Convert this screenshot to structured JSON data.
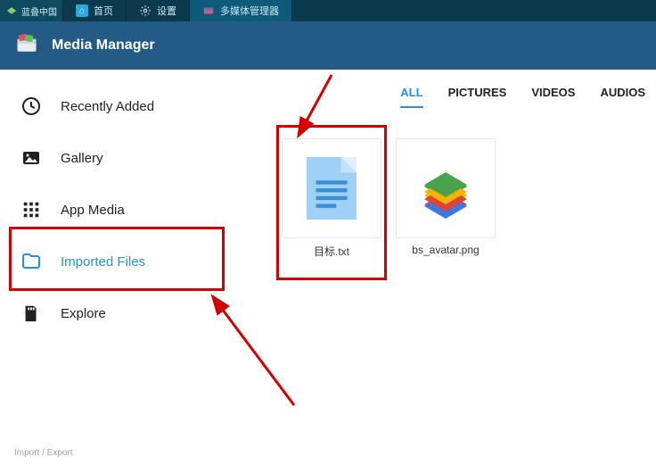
{
  "brand": {
    "text": "蓝叠中国"
  },
  "tabs": [
    {
      "label": "首页",
      "icon": "home"
    },
    {
      "label": "设置",
      "icon": "gear"
    },
    {
      "label": "多媒体管理器",
      "icon": "media",
      "active": true
    }
  ],
  "header": {
    "title": "Media Manager"
  },
  "sidebar": {
    "items": [
      {
        "label": "Recently Added",
        "icon": "clock"
      },
      {
        "label": "Gallery",
        "icon": "image"
      },
      {
        "label": "App Media",
        "icon": "grid"
      },
      {
        "label": "Imported Files",
        "icon": "folder",
        "selected": true
      },
      {
        "label": "Explore",
        "icon": "sd"
      }
    ],
    "footer": "Import / Export"
  },
  "filters": [
    {
      "label": "ALL",
      "active": true
    },
    {
      "label": "PICTURES"
    },
    {
      "label": "VIDEOS"
    },
    {
      "label": "AUDIOS"
    }
  ],
  "files": [
    {
      "name": "目标.txt",
      "kind": "doc"
    },
    {
      "name": "bs_avatar.png",
      "kind": "bluestacks-logo"
    }
  ],
  "accent": "#2c8ee6"
}
